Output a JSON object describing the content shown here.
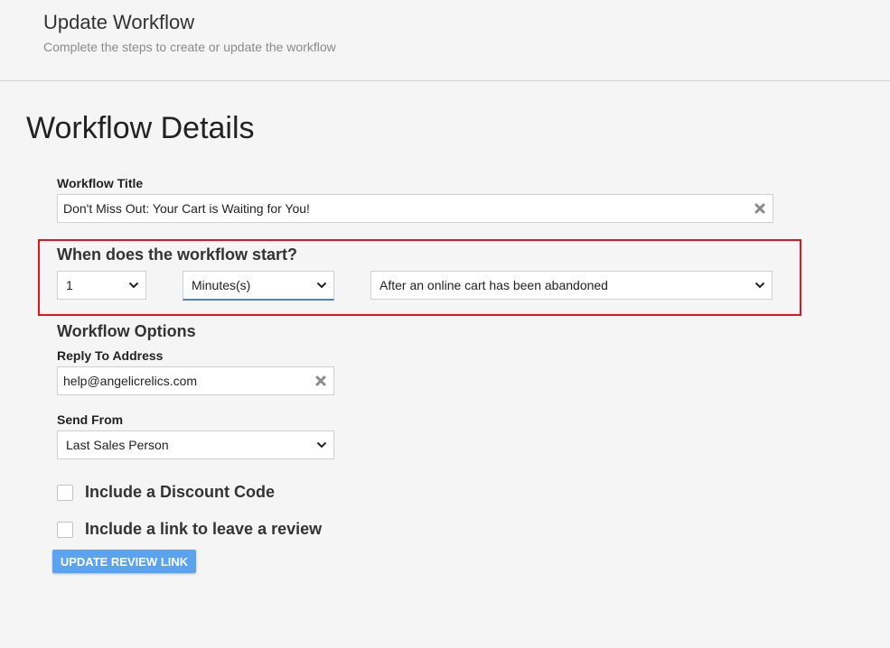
{
  "header": {
    "title": "Update Workflow",
    "subtitle": "Complete the steps to create or update the workflow"
  },
  "section_title": "Workflow Details",
  "workflow_title": {
    "label": "Workflow Title",
    "value": "Don't Miss Out: Your Cart is Waiting for You!"
  },
  "start": {
    "question": "When does the workflow start?",
    "amount": "1",
    "unit": "Minutes(s)",
    "trigger": "After an online cart has been abandoned"
  },
  "options": {
    "heading": "Workflow Options",
    "reply_to_label": "Reply To Address",
    "reply_to_value": "help@angelicrelics.com",
    "send_from_label": "Send From",
    "send_from_value": "Last Sales Person"
  },
  "checkboxes": {
    "discount_label": "Include a Discount Code",
    "review_label": "Include a link to leave a review"
  },
  "buttons": {
    "update_review_link": "UPDATE REVIEW LINK"
  },
  "colors": {
    "highlight": "#e0161f",
    "button": "#5ba3ee",
    "focus": "#4a7fd6"
  }
}
